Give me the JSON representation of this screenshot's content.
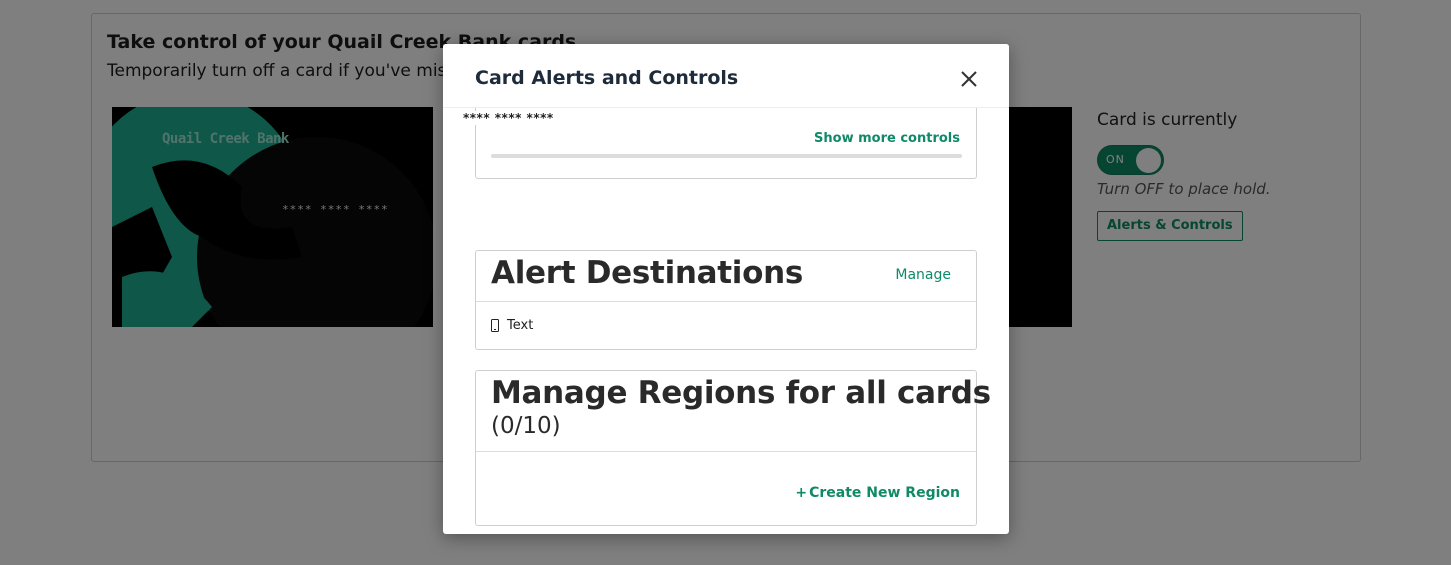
{
  "background": {
    "title": "Take control of your Quail Creek Bank cards",
    "subtitle": "Temporarily turn off a card if you've misplaced it.",
    "card": {
      "brand": "Quail Creek Bank",
      "masked_number": "**** **** ****"
    },
    "status": {
      "heading": "Card is currently",
      "toggle_label": "ON",
      "toggle_on": true,
      "hint": "Turn OFF to place hold.",
      "alerts_button": "Alerts & Controls"
    }
  },
  "modal": {
    "title": "Card Alerts and Controls",
    "close_icon": "close-icon",
    "masked_number": "**** **** ****",
    "controls": {
      "show_more_label": "Show more controls"
    },
    "alert_destinations": {
      "title": "Alert Destinations",
      "manage_label": "Manage",
      "items": [
        {
          "icon": "phone-icon",
          "label": "Text"
        }
      ]
    },
    "regions": {
      "title": "Manage Regions for all cards",
      "count": "(0/10)",
      "create_label": "Create New Region",
      "create_icon": "plus-icon"
    }
  },
  "colors": {
    "accent": "#0f8a67",
    "card_teal": "#1fae92",
    "overlay": "rgba(0,0,0,0.5)"
  }
}
